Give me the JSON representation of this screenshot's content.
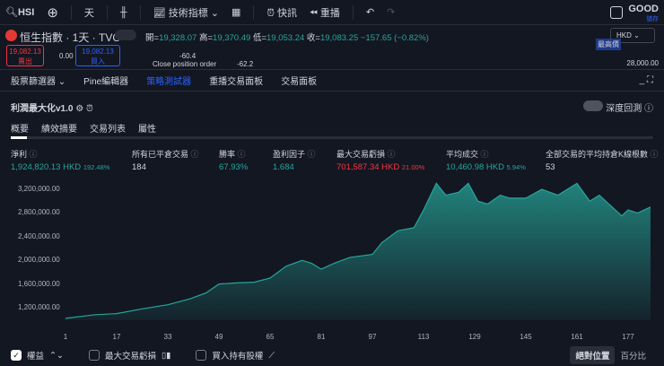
{
  "toolbar": {
    "symbol": "HSI",
    "interval": "天",
    "indicators": "技術指標",
    "alerts": "快訊",
    "replay": "重播",
    "account": "GOOD",
    "account_sub": "儲存"
  },
  "legend": {
    "title": "恒生指數 · 1天 · TVC",
    "open_label": "開=",
    "open": "19,328.07",
    "high_label": "高=",
    "high": "19,370.49",
    "low_label": "低=",
    "low": "19,053.24",
    "close_label": "收=",
    "close": "19,083.25",
    "change": "−157.65 (−0.82%)",
    "sell_price": "19,082.13",
    "sell_label": "賣出",
    "spread": "0.00",
    "buy_price": "19,082.13",
    "buy_label": "買入",
    "val1": "-60.4",
    "close_order": "Close position order",
    "val2": "-62.2",
    "currency": "HKD",
    "max_price_label": "最高價",
    "price_level": "28,000.00"
  },
  "panel_tabs": [
    "股票篩選器",
    "Pine編輯器",
    "策略測試器",
    "重播交易面板",
    "交易面板"
  ],
  "strategy": {
    "name": "利潤最大化v1.0",
    "deep_backtest": "深度回測"
  },
  "sub_tabs": [
    "概要",
    "績效摘要",
    "交易列表",
    "屬性"
  ],
  "stats": [
    {
      "label": "淨利",
      "value": "1,924,820.13 HKD",
      "pct": "192.48%",
      "color": "g"
    },
    {
      "label": "所有已平倉交易",
      "value": "184",
      "pct": "",
      "color": ""
    },
    {
      "label": "勝率",
      "value": "67.93%",
      "pct": "",
      "color": "g"
    },
    {
      "label": "盈利因子",
      "value": "1.684",
      "pct": "",
      "color": "g"
    },
    {
      "label": "最大交易虧損",
      "value": "701,587.34 HKD",
      "pct": "21.00%",
      "color": "r"
    },
    {
      "label": "平均成交",
      "value": "10,460.98 HKD",
      "pct": "5.94%",
      "color": "g"
    },
    {
      "label": "全部交易的平均持倉K線根數",
      "value": "53",
      "pct": "",
      "color": ""
    }
  ],
  "chart_data": {
    "type": "area",
    "title": "",
    "xlabel": "",
    "ylabel": "",
    "y_ticks": [
      "3,200,000.00",
      "2,800,000.00",
      "2,400,000.00",
      "2,000,000.00",
      "1,600,000.00",
      "1,200,000.00"
    ],
    "y_tick_values": [
      3200000,
      2800000,
      2400000,
      2000000,
      1600000,
      1200000
    ],
    "x_ticks": [
      1,
      17,
      33,
      49,
      65,
      81,
      97,
      113,
      129,
      145,
      161,
      177
    ],
    "xlim": [
      1,
      184
    ],
    "ylim": [
      1000000,
      3400000
    ],
    "series": [
      {
        "name": "權益",
        "x": [
          1,
          10,
          17,
          25,
          33,
          40,
          45,
          49,
          55,
          60,
          65,
          70,
          75,
          78,
          81,
          85,
          90,
          97,
          100,
          105,
          110,
          113,
          117,
          120,
          124,
          127,
          130,
          133,
          137,
          140,
          145,
          150,
          155,
          158,
          161,
          165,
          168,
          172,
          175,
          177,
          180,
          184
        ],
        "values": [
          1020000,
          1080000,
          1100000,
          1180000,
          1250000,
          1350000,
          1450000,
          1600000,
          1620000,
          1630000,
          1700000,
          1900000,
          2000000,
          1950000,
          1850000,
          1950000,
          2050000,
          2100000,
          2300000,
          2500000,
          2550000,
          2850000,
          3300000,
          3100000,
          3150000,
          3300000,
          3000000,
          2950000,
          3100000,
          3050000,
          3050000,
          3200000,
          3100000,
          3200000,
          3300000,
          3000000,
          3100000,
          2900000,
          2750000,
          2850000,
          2800000,
          2900000
        ]
      }
    ],
    "color": "#26a69a"
  },
  "bottom": {
    "equity": "權益",
    "max_dd": "最大交易虧損",
    "buy_hold": "買入持有股權",
    "absolute": "絕對位置",
    "percent": "百分比"
  }
}
